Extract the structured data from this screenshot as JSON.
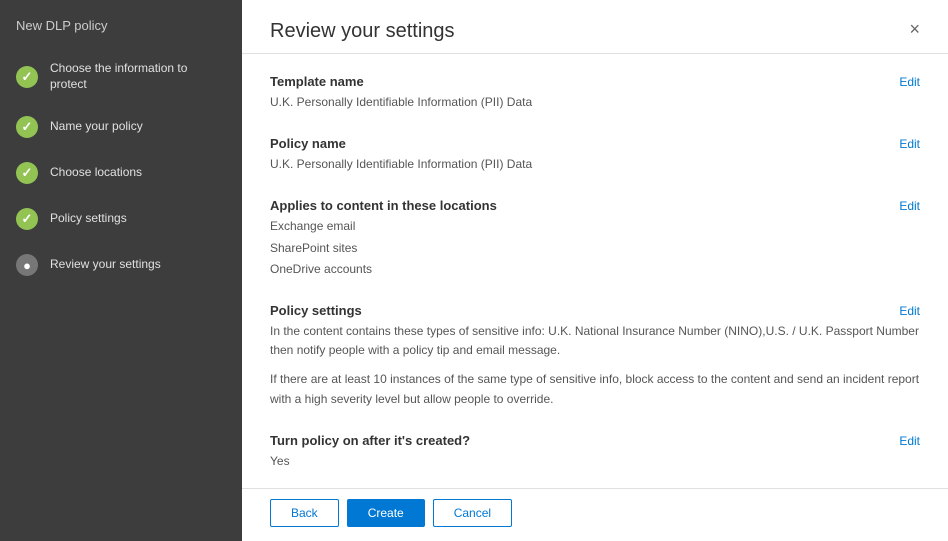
{
  "sidebar": {
    "title": "New DLP policy",
    "items": [
      {
        "id": "choose-info",
        "label": "Choose the information to protect",
        "status": "completed"
      },
      {
        "id": "name-policy",
        "label": "Name your policy",
        "status": "completed"
      },
      {
        "id": "choose-locations",
        "label": "Choose locations",
        "status": "completed"
      },
      {
        "id": "policy-settings",
        "label": "Policy settings",
        "status": "completed"
      },
      {
        "id": "review-settings",
        "label": "Review your settings",
        "status": "inactive"
      }
    ]
  },
  "main": {
    "title": "Review your settings",
    "close_label": "×",
    "sections": [
      {
        "id": "template-name",
        "label": "Template name",
        "edit_label": "Edit",
        "value": "U.K. Personally Identifiable Information (PII) Data"
      },
      {
        "id": "policy-name",
        "label": "Policy name",
        "edit_label": "Edit",
        "value": "U.K. Personally Identifiable Information (PII) Data"
      },
      {
        "id": "applies-to",
        "label": "Applies to content in these locations",
        "edit_label": "Edit",
        "values": [
          "Exchange email",
          "SharePoint sites",
          "OneDrive accounts"
        ]
      },
      {
        "id": "policy-settings",
        "label": "Policy settings",
        "edit_label": "Edit",
        "paragraphs": [
          "In the content contains these types of sensitive info: U.K. National Insurance Number (NINO),U.S. / U.K. Passport Number then notify people with a policy tip and email message.",
          "If there are at least 10 instances of the same type of sensitive info, block access to the content and send an incident report with a high severity level but allow people to override."
        ]
      },
      {
        "id": "turn-policy-on",
        "label": "Turn policy on after it's created?",
        "edit_label": "Edit",
        "value": "Yes"
      }
    ],
    "footer": {
      "back_label": "Back",
      "create_label": "Create",
      "cancel_label": "Cancel"
    }
  }
}
